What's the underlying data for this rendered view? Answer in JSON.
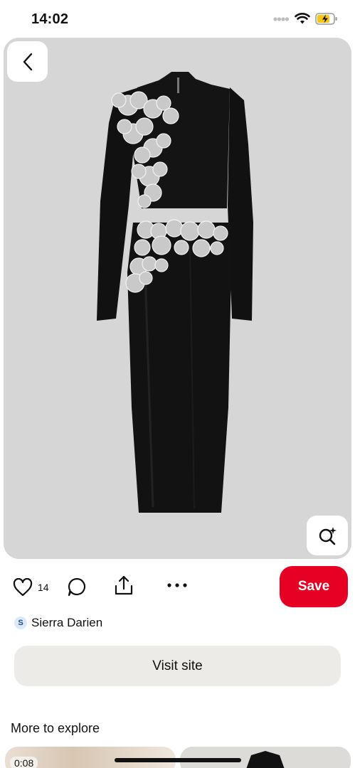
{
  "status_bar": {
    "time": "14:02",
    "icons": [
      "cellular-dots-icon",
      "wifi-icon",
      "battery-charging-icon"
    ],
    "battery_color": "#f5c518"
  },
  "pin": {
    "image_subject": "black-dress-with-crystal-flowers",
    "background_color": "#d6d6d6",
    "back_icon": "chevron-left-icon",
    "lens_icon": "visual-search-icon"
  },
  "actions": {
    "like_icon": "heart-icon",
    "like_count": "14",
    "comment_icon": "comment-icon",
    "share_icon": "share-icon",
    "more_icon": "more-icon",
    "save_label": "Save",
    "save_color": "#e60023"
  },
  "source": {
    "avatar_letter": "S",
    "name": "Sierra Darien"
  },
  "visit_label": "Visit site",
  "explore": {
    "title": "More to explore",
    "first_duration": "0:08"
  }
}
